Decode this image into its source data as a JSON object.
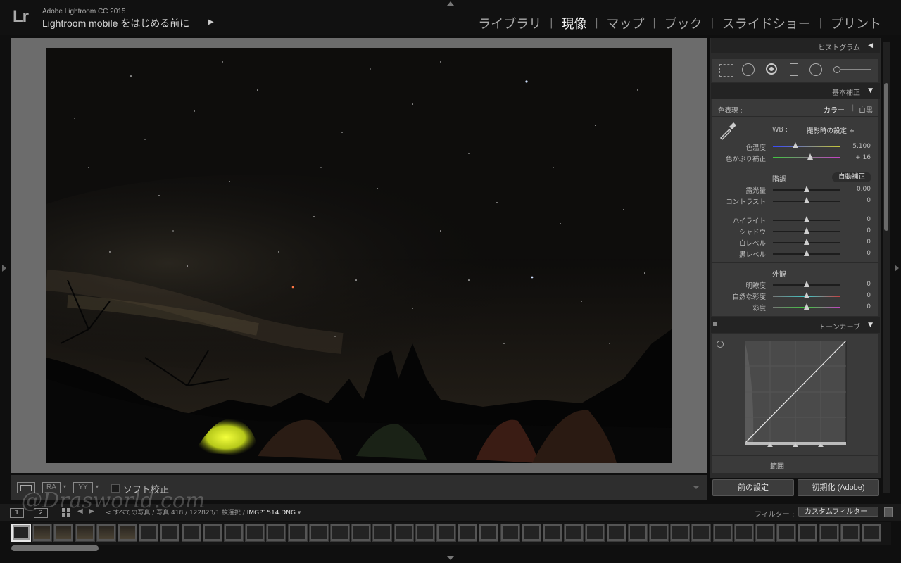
{
  "app": {
    "logo": "Lr",
    "name": "Adobe Lightroom CC 2015",
    "mobile_prompt": "Lightroom mobile をはじめる前に",
    "mobile_arrow": "▶"
  },
  "modules": [
    {
      "label": "ライブラリ",
      "active": false
    },
    {
      "label": "現像",
      "active": true
    },
    {
      "label": "マップ",
      "active": false
    },
    {
      "label": "ブック",
      "active": false
    },
    {
      "label": "スライドショー",
      "active": false
    },
    {
      "label": "プリント",
      "active": false
    }
  ],
  "module_separator": "|",
  "toolbar": {
    "ra_label": "RA",
    "yy_label": "YY",
    "soft_proof_label": "ソフト校正",
    "soft_proof_checked": false
  },
  "panels": {
    "histogram": {
      "title": "ヒストグラム",
      "toggle": "◀"
    },
    "basic": {
      "title": "基本補正",
      "toggle": "▼",
      "treatment_label": "色表現 :",
      "treatment_color": "カラー",
      "treatment_sep": "|",
      "treatment_bw": "白黒",
      "wb_label": "WB :",
      "wb_value": "撮影時の設定 ÷",
      "temp": {
        "label": "色温度",
        "value": "5,100",
        "position": 0.33
      },
      "tint": {
        "label": "色かぶり補正",
        "value": "+ 16",
        "position": 0.55
      },
      "tone_label": "階調",
      "auto_button": "自動補正",
      "tone_sliders": [
        {
          "label": "露光量",
          "value": "0.00",
          "position": 0.5
        },
        {
          "label": "コントラスト",
          "value": "0",
          "position": 0.5
        }
      ],
      "range_sliders": [
        {
          "label": "ハイライト",
          "value": "0",
          "position": 0.5
        },
        {
          "label": "シャドウ",
          "value": "0",
          "position": 0.5
        },
        {
          "label": "白レベル",
          "value": "0",
          "position": 0.5
        },
        {
          "label": "黒レベル",
          "value": "0",
          "position": 0.5
        }
      ],
      "presence_label": "外観",
      "presence_sliders": [
        {
          "label": "明瞭度",
          "value": "0",
          "position": 0.5
        },
        {
          "label": "自然な彩度",
          "value": "0",
          "position": 0.5
        },
        {
          "label": "彩度",
          "value": "0",
          "position": 0.5
        }
      ]
    },
    "tone_curve": {
      "title": "トーンカーブ",
      "toggle": "▼",
      "range_label": "範囲"
    }
  },
  "buttons": {
    "previous": "前の設定",
    "reset": "初期化 (Adobe)"
  },
  "filmstrip": {
    "view1": "1",
    "view2": "2",
    "path_prefix": "< すべての写真 / 写真 418 / 122823/1 枚選択 /",
    "filename": "IMGP1514.DNG",
    "filename_suffix": "▾",
    "filter_label": "フィルター :",
    "filter_value": "カスタムフィルター",
    "thumb_count": 41
  },
  "watermark": "@Drasworld.com"
}
